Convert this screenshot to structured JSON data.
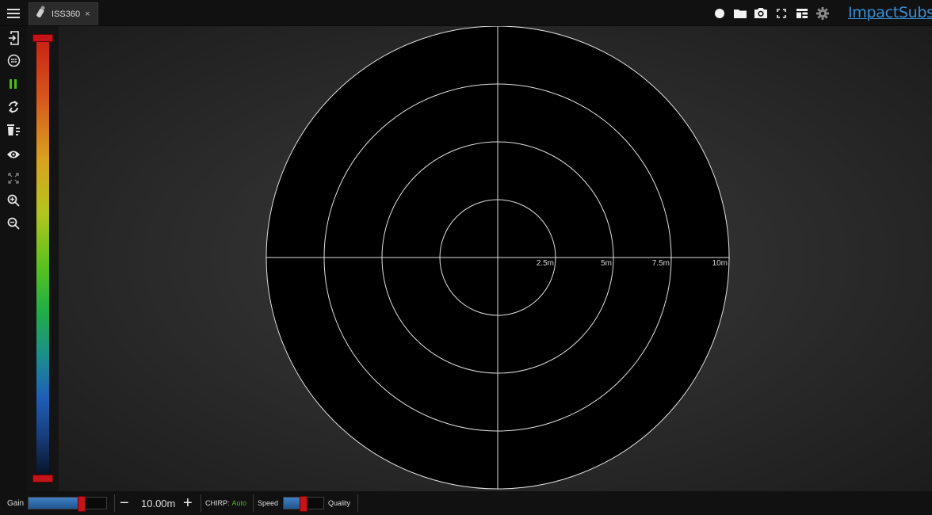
{
  "tab": {
    "label": "ISS360",
    "close": "×"
  },
  "brand": {
    "name": "ImpactSubsea"
  },
  "toolbar_icons": [
    "menu-icon",
    "record-icon",
    "folder-icon",
    "camera-icon",
    "fullscreen-icon",
    "layout-icon",
    "gear-icon"
  ],
  "left_icons": [
    "connect-icon",
    "sonar-head-icon",
    "pause-icon",
    "rotate-icon",
    "clear-icon",
    "eye-icon",
    "fit-icon",
    "zoom-in-icon",
    "zoom-out-icon"
  ],
  "colors": {
    "accent": "#3a8fd6",
    "pause": "#4cbb17",
    "chirp_value": "#4cbb17",
    "handle": "#c4141a"
  },
  "scale": {
    "top_handle": 1.0,
    "bottom_handle": 0.0
  },
  "sonar": {
    "range_labels": [
      "2.5m",
      "5m",
      "7.5m",
      "10m"
    ]
  },
  "bottom": {
    "gain_label": "Gain",
    "gain_level": 0.68,
    "range_minus": "−",
    "range_value": "10.00m",
    "range_plus": "+",
    "chirp_label": "CHIRP:",
    "chirp_value": "Auto",
    "speed_label": "Speed",
    "speed_quality_level": 0.5,
    "quality_label": "Quality"
  }
}
